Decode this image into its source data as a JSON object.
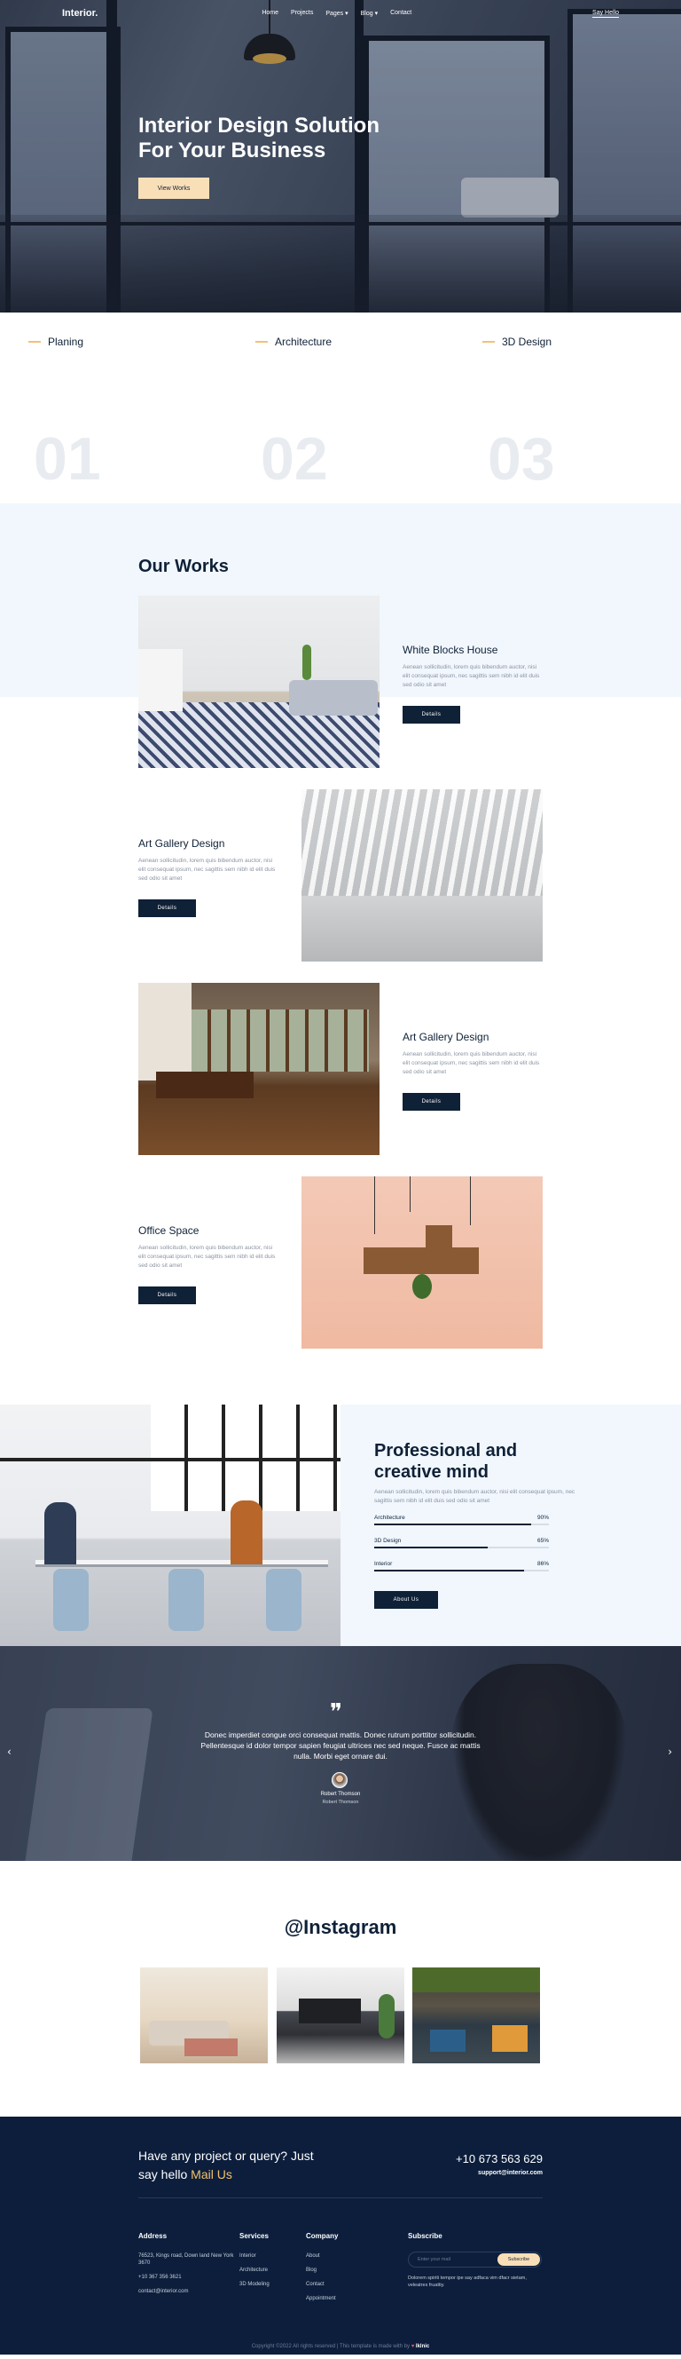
{
  "nav": {
    "logo": "Interior.",
    "menu": [
      "Home",
      "Projects",
      "Pages ▾",
      "Blog ▾",
      "Contact"
    ],
    "cta": "Say Hello"
  },
  "hero": {
    "title_line1": "Interior Design Solution",
    "title_line2": "For Your Business",
    "button": "View Works"
  },
  "services": [
    {
      "name": "Planing",
      "number": "01"
    },
    {
      "name": "Architecture",
      "number": "02"
    },
    {
      "name": "3D Design",
      "number": "03"
    }
  ],
  "works": {
    "title": "Our Works",
    "items": [
      {
        "title": "White Blocks House",
        "desc": "Aenean sollicitudin, lorem quis bibendum auctor, nisi elit consequat ipsum, nec sagittis sem nibh id elit duis sed odio sit amet",
        "button": "Details"
      },
      {
        "title": "Art Gallery Design",
        "desc": "Aenean sollicitudin, lorem quis bibendum auctor, nisi elit consequat ipsum, nec sagittis sem nibh id elit duis sed odio sit amet",
        "button": "Details"
      },
      {
        "title": "Art Gallery Design",
        "desc": "Aenean sollicitudin, lorem quis bibendum auctor, nisi elit consequat ipsum, nec sagittis sem nibh id elit duis sed odio sit amet",
        "button": "Details"
      },
      {
        "title": "Office Space",
        "desc": "Aenean sollicitudin, lorem quis bibendum auctor, nisi elit consequat ipsum, nec sagittis sem nibh id elit duis sed odio sit amet",
        "button": "Details"
      }
    ]
  },
  "pro": {
    "title": "Professional and creative mind",
    "desc": "Aenean sollicitudin, lorem quis bibendum auctor, nisi elit consequat ipsum, nec sagittis sem nibh id elit duis sed odio sit amet",
    "skills": [
      {
        "label": "Architecture",
        "value": "90%",
        "fraction": 0.9
      },
      {
        "label": "3D Design",
        "value": "65%",
        "fraction": 0.65
      },
      {
        "label": "Interior",
        "value": "86%",
        "fraction": 0.86
      }
    ],
    "button": "About Us"
  },
  "testimonial": {
    "quote": "Donec imperdiet congue orci consequat mattis. Donec rutrum porttitor sollicitudin. Pellentesque id dolor tempor sapien feugiat ultrices nec sed neque. Fusce ac mattis nulla. Morbi eget ornare dui.",
    "name": "Robert Thomson",
    "role": "Robert Thomson",
    "prev": "‹",
    "next": "›"
  },
  "instagram": {
    "title": "@Instagram"
  },
  "footer": {
    "cta_line1": "Have any project or query? Just",
    "cta_line2_prefix": "say hello",
    "cta_line2_accent": "Mail Us",
    "phone": "+10 673 563 629",
    "email": "support@interior.com",
    "address": {
      "heading": "Address",
      "lines": [
        "76523, Kings road, Down land New York 3670",
        "+10 367 356 3621",
        "contact@interior.com"
      ]
    },
    "services": {
      "heading": "Services",
      "items": [
        "Interior",
        "Architecture",
        "3D Modeling"
      ]
    },
    "company": {
      "heading": "Company",
      "items": [
        "About",
        "Blog",
        "Contact",
        "Appointment"
      ]
    },
    "subscribe": {
      "heading": "Subscribe",
      "placeholder": "Enter your mail",
      "button": "Subscribe",
      "note": "Dolorem spiriti tempor ipe say adfaca vim dfacr sietam, veleatres fruattiy."
    },
    "copyright_text": "Copyright ©2022 All rights reserved | This template is made with by",
    "copyright_brand": "Iklnic"
  },
  "colors": {
    "navy": "#0f2137",
    "accent": "#f9dfb7",
    "gold": "#f4c26b",
    "light_bg": "#f1f7fd"
  }
}
